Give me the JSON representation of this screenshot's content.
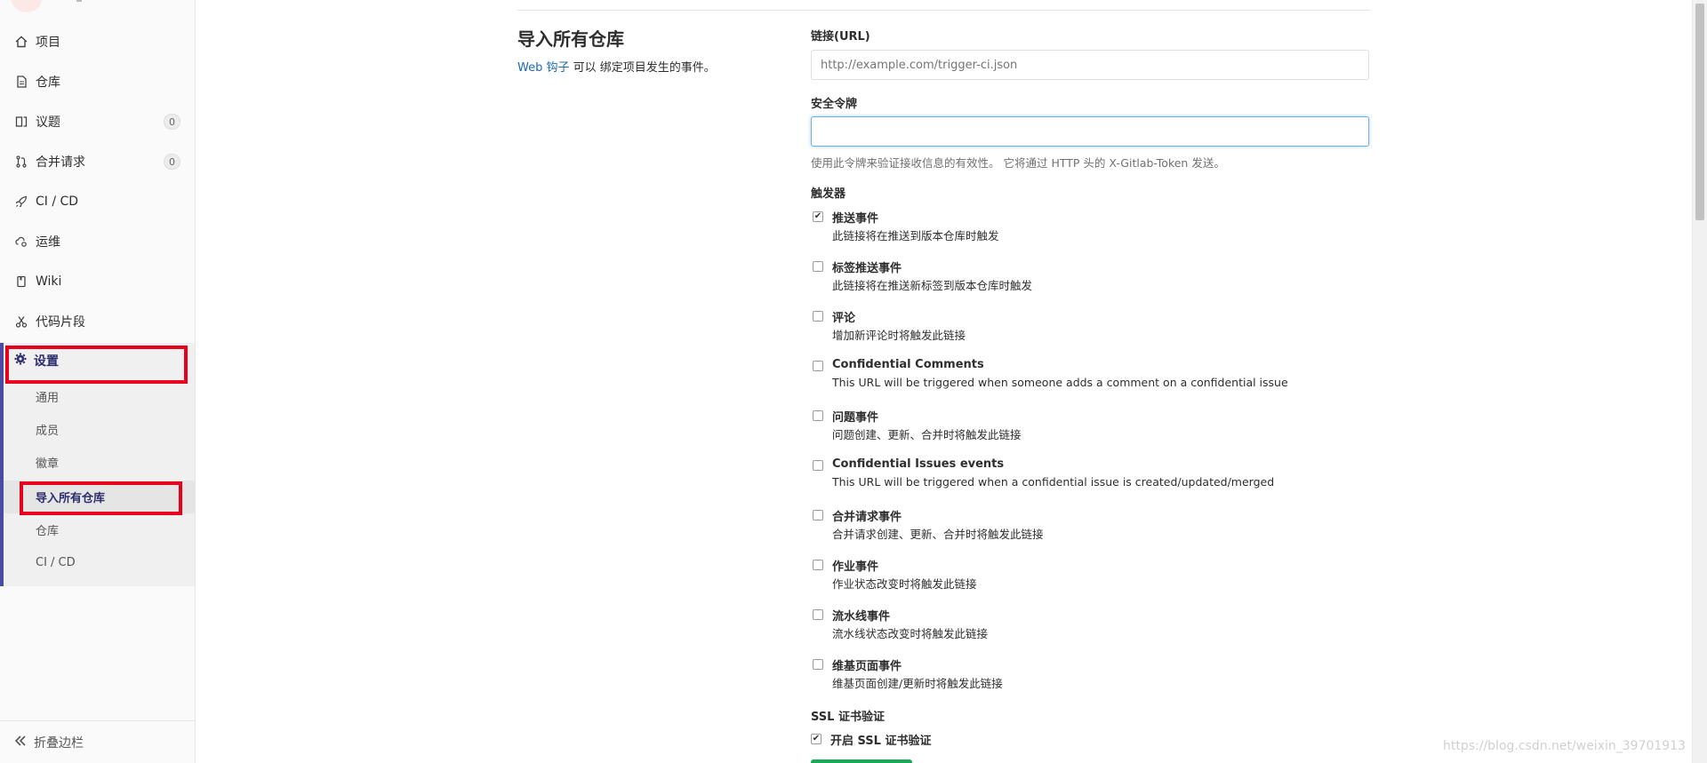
{
  "sidebar": {
    "items": [
      {
        "label": "项目",
        "icon": "home-icon"
      },
      {
        "label": "仓库",
        "icon": "doc-icon"
      },
      {
        "label": "议题",
        "icon": "issues-icon",
        "badge": "0"
      },
      {
        "label": "合并请求",
        "icon": "merge-request-icon",
        "badge": "0"
      },
      {
        "label": "CI / CD",
        "icon": "rocket-icon"
      },
      {
        "label": "运维",
        "icon": "cloud-gear-icon"
      },
      {
        "label": "Wiki",
        "icon": "book-icon"
      },
      {
        "label": "代码片段",
        "icon": "scissors-icon"
      }
    ],
    "settings": {
      "label": "设置",
      "icon": "gear-icon",
      "sub_items": [
        "通用",
        "成员",
        "徽章",
        "导入所有仓库",
        "仓库",
        "CI / CD"
      ],
      "active_sub_item": "导入所有仓库"
    },
    "collapse_label": "折叠边栏"
  },
  "section": {
    "title": "导入所有仓库",
    "desc_link": "Web 钩子",
    "desc_text": " 可以 绑定项目发生的事件。"
  },
  "form": {
    "url_label": "链接(URL)",
    "url_placeholder": "http://example.com/trigger-ci.json",
    "url_value": "",
    "token_label": "安全令牌",
    "token_value": "",
    "token_help": "使用此令牌来验证接收信息的有效性。 它将通过 HTTP 头的 X-Gitlab-Token 发送。",
    "triggers_label": "触发器",
    "triggers": [
      {
        "title": "推送事件",
        "desc": "此链接将在推送到版本仓库时触发",
        "checked": true
      },
      {
        "title": "标签推送事件",
        "desc": "此链接将在推送新标签到版本仓库时触发",
        "checked": false
      },
      {
        "title": "评论",
        "desc": "增加新评论时将触发此链接",
        "checked": false
      },
      {
        "title": "Confidential Comments",
        "desc": "This URL will be triggered when someone adds a comment on a confidential issue",
        "checked": false
      },
      {
        "title": "问题事件",
        "desc": "问题创建、更新、合并时将触发此链接",
        "checked": false
      },
      {
        "title": "Confidential Issues events",
        "desc": "This URL will be triggered when a confidential issue is created/updated/merged",
        "checked": false
      },
      {
        "title": "合并请求事件",
        "desc": "合并请求创建、更新、合并时将触发此链接",
        "checked": false
      },
      {
        "title": "作业事件",
        "desc": "作业状态改变时将触发此链接",
        "checked": false
      },
      {
        "title": "流水线事件",
        "desc": "流水线状态改变时将触发此链接",
        "checked": false
      },
      {
        "title": "维基页面事件",
        "desc": "维基页面创建/更新时将触发此链接",
        "checked": false
      }
    ],
    "ssl_label": "SSL 证书验证",
    "ssl_option": "开启 SSL 证书验证",
    "ssl_checked": true
  },
  "colors": {
    "highlight_box": "#e8001c",
    "settings_accent": "#4b4ba3",
    "link": "#1b69b6",
    "submit_button": "#1aaa55"
  },
  "watermark": "https://blog.csdn.net/weixin_39701913"
}
